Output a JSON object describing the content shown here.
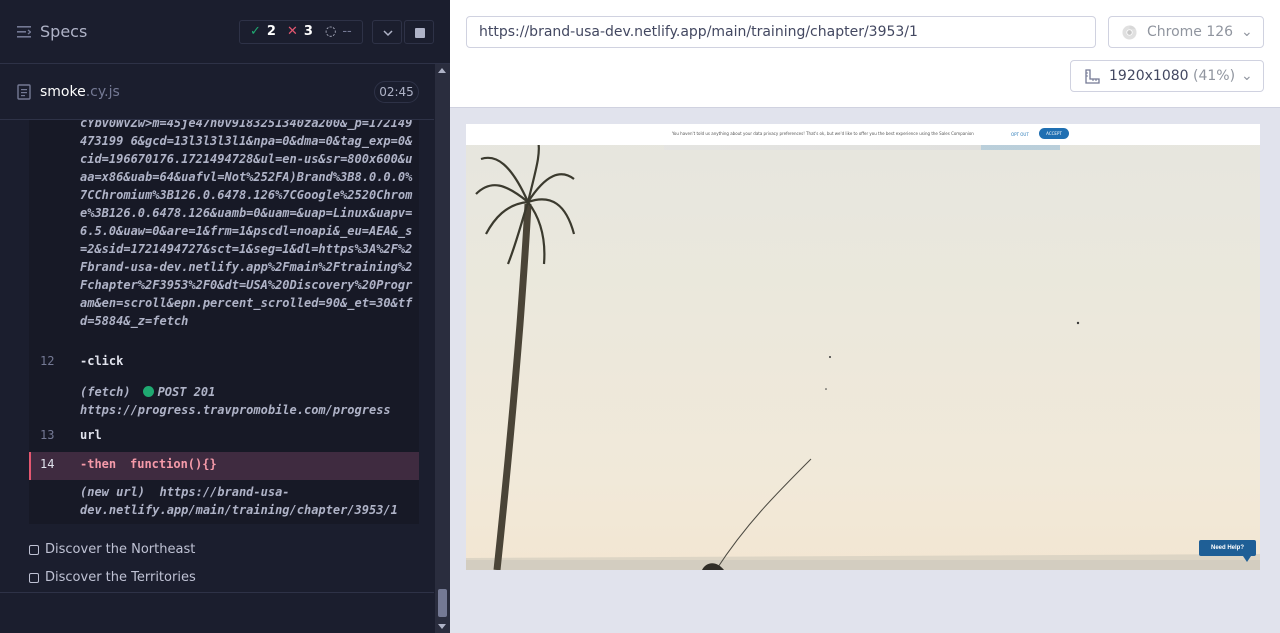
{
  "specs": {
    "title": "Specs",
    "stats": {
      "passed": "2",
      "failed": "3",
      "pending": "--"
    }
  },
  "spec_file": {
    "name": "smoke",
    "ext": ".cy.js",
    "duration": "02:45"
  },
  "log": {
    "url_text": "cYbv0WvZw>m=45je47h0v9183251340za200&_p=172149473199 6&gcd=13l3l3l3l1&npa=0&dma=0&tag_exp=0&cid=196670176.1721494728&ul=en-us&sr=800x600&uaa=x86&uab=64&uafvl=Not%252FA)Brand%3B8.0.0.0%7CChromium%3B126.0.6478.126%7CGoogle%2520Chrome%3B126.0.6478.126&uamb=0&uam=&uap=Linux&uapv=6.5.0&uaw=0&are=1&frm=1&pscdl=noapi&_eu=AEA&_s=2&sid=1721494727&sct=1&seg=1&dl=https%3A%2F%2Fbrand-usa-dev.netlify.app%2Fmain%2Ftraining%2Fchapter%2F3953%2F0&dt=USA%20Discovery%20Program&en=scroll&epn.percent_scrolled=90&_et=30&tfd=5884&_z=fetch",
    "commands": [
      {
        "num": "12",
        "name": "-click",
        "sub_prefix": "(fetch)",
        "sub_status": "POST 201",
        "sub_url": "https://progress.travpromobile.com/progress"
      },
      {
        "num": "13",
        "name": "url"
      },
      {
        "num": "14",
        "name": "-then",
        "message": "function(){}",
        "sub_prefix": "(new url)",
        "sub_url": "https://brand-usa-dev.netlify.app/main/training/chapter/3953/1"
      }
    ]
  },
  "suites": [
    {
      "label": "Discover the Northeast"
    },
    {
      "label": "Discover the Territories"
    }
  ],
  "browser": {
    "url": "https://brand-usa-dev.netlify.app/main/training/chapter/3953/1",
    "name": "Chrome 126",
    "viewport": "1920x1080",
    "scale": "(41%)"
  },
  "aut": {
    "consent_text": "You haven't told us anything about your data privacy preferences! That's ok, but we'd like to offer you the best experience using the Sales Companion",
    "consent_optout": "OPT OUT",
    "consent_accept": "ACCEPT",
    "need_help": "Need Help?"
  },
  "colors": {
    "pass": "#1fa971",
    "fail": "#e45770",
    "accent": "#1f6fb2"
  }
}
